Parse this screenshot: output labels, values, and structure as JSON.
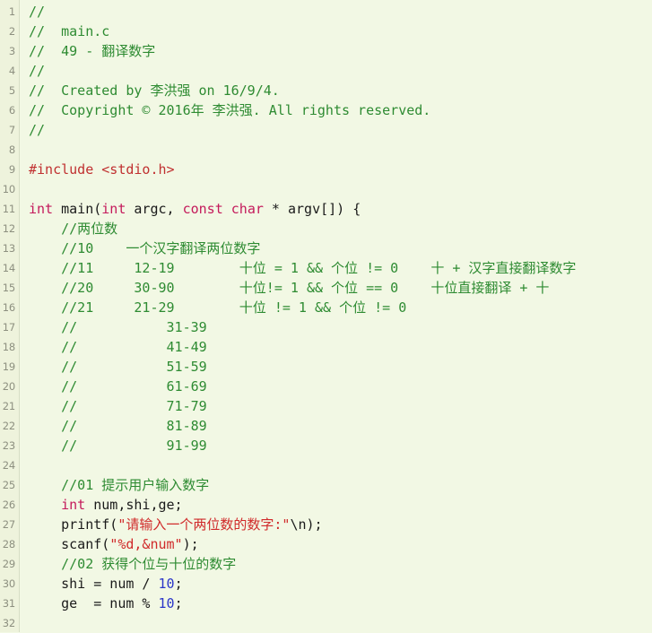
{
  "editor": {
    "language": "c",
    "first_visible_line": 1,
    "last_visible_line": 32,
    "colors": {
      "background": "#f2f8e4",
      "gutter_background": "#eef3dc",
      "gutter_border": "#d6dec4",
      "line_number": "#8d9080",
      "comment": "#2e8b32",
      "keyword": "#c41a5b",
      "preprocessor": "#c03030",
      "string": "#d02a2a",
      "number": "#2b36c8",
      "plain_text": "#1a1a1a"
    }
  },
  "line_numbers": [
    1,
    2,
    3,
    4,
    5,
    6,
    7,
    8,
    9,
    10,
    11,
    12,
    13,
    14,
    15,
    16,
    17,
    18,
    19,
    20,
    21,
    22,
    23,
    24,
    25,
    26,
    27,
    28,
    29,
    30,
    31,
    32
  ],
  "lines": [
    {
      "n": 1,
      "tokens": [
        {
          "t": "//",
          "c": "cmt"
        }
      ]
    },
    {
      "n": 2,
      "tokens": [
        {
          "t": "//  main.c",
          "c": "cmt"
        }
      ]
    },
    {
      "n": 3,
      "tokens": [
        {
          "t": "//  49 - 翻译数字",
          "c": "cmt"
        }
      ]
    },
    {
      "n": 4,
      "tokens": [
        {
          "t": "//",
          "c": "cmt"
        }
      ]
    },
    {
      "n": 5,
      "tokens": [
        {
          "t": "//  Created by 李洪强 on 16/9/4.",
          "c": "cmt"
        }
      ]
    },
    {
      "n": 6,
      "tokens": [
        {
          "t": "//  Copyright © 2016年 李洪强. All rights reserved.",
          "c": "cmt"
        }
      ]
    },
    {
      "n": 7,
      "tokens": [
        {
          "t": "//",
          "c": "cmt"
        }
      ]
    },
    {
      "n": 8,
      "tokens": [
        {
          "t": "",
          "c": "plain"
        }
      ]
    },
    {
      "n": 9,
      "tokens": [
        {
          "t": "#include ",
          "c": "pre"
        },
        {
          "t": "<stdio.h>",
          "c": "pre"
        }
      ]
    },
    {
      "n": 10,
      "tokens": [
        {
          "t": "",
          "c": "plain"
        }
      ]
    },
    {
      "n": 11,
      "tokens": [
        {
          "t": "int",
          "c": "kw"
        },
        {
          "t": " main(",
          "c": "plain"
        },
        {
          "t": "int",
          "c": "kw"
        },
        {
          "t": " argc, ",
          "c": "plain"
        },
        {
          "t": "const",
          "c": "kw"
        },
        {
          "t": " ",
          "c": "plain"
        },
        {
          "t": "char",
          "c": "kw"
        },
        {
          "t": " * argv[]) {",
          "c": "plain"
        }
      ]
    },
    {
      "n": 12,
      "tokens": [
        {
          "t": "    //两位数",
          "c": "cmt"
        }
      ]
    },
    {
      "n": 13,
      "tokens": [
        {
          "t": "    //10    一个汉字翻译两位数字",
          "c": "cmt"
        }
      ]
    },
    {
      "n": 14,
      "tokens": [
        {
          "t": "    //11     12-19        十位 = 1 && 个位 != 0    十 + 汉字直接翻译数字",
          "c": "cmt"
        }
      ]
    },
    {
      "n": 15,
      "tokens": [
        {
          "t": "    //20     30-90        十位!= 1 && 个位 == 0    十位直接翻译 + 十",
          "c": "cmt"
        }
      ]
    },
    {
      "n": 16,
      "tokens": [
        {
          "t": "    //21     21-29        十位 != 1 && 个位 != 0",
          "c": "cmt"
        }
      ]
    },
    {
      "n": 17,
      "tokens": [
        {
          "t": "    //           31-39",
          "c": "cmt"
        }
      ]
    },
    {
      "n": 18,
      "tokens": [
        {
          "t": "    //           41-49",
          "c": "cmt"
        }
      ]
    },
    {
      "n": 19,
      "tokens": [
        {
          "t": "    //           51-59",
          "c": "cmt"
        }
      ]
    },
    {
      "n": 20,
      "tokens": [
        {
          "t": "    //           61-69",
          "c": "cmt"
        }
      ]
    },
    {
      "n": 21,
      "tokens": [
        {
          "t": "    //           71-79",
          "c": "cmt"
        }
      ]
    },
    {
      "n": 22,
      "tokens": [
        {
          "t": "    //           81-89",
          "c": "cmt"
        }
      ]
    },
    {
      "n": 23,
      "tokens": [
        {
          "t": "    //           91-99",
          "c": "cmt"
        }
      ]
    },
    {
      "n": 24,
      "tokens": [
        {
          "t": "",
          "c": "plain"
        }
      ]
    },
    {
      "n": 25,
      "tokens": [
        {
          "t": "    //01 提示用户输入数字",
          "c": "cmt"
        }
      ]
    },
    {
      "n": 26,
      "tokens": [
        {
          "t": "    ",
          "c": "plain"
        },
        {
          "t": "int",
          "c": "kw"
        },
        {
          "t": " num,shi,ge;",
          "c": "plain"
        }
      ]
    },
    {
      "n": 27,
      "tokens": [
        {
          "t": "    printf(",
          "c": "plain"
        },
        {
          "t": "\"请输入一个两位数的数字:\"",
          "c": "str"
        },
        {
          "t": "\\n);",
          "c": "plain"
        }
      ]
    },
    {
      "n": 28,
      "tokens": [
        {
          "t": "    scanf(",
          "c": "plain"
        },
        {
          "t": "\"%d,&num\"",
          "c": "str"
        },
        {
          "t": ");",
          "c": "plain"
        }
      ]
    },
    {
      "n": 29,
      "tokens": [
        {
          "t": "    //02 获得个位与十位的数字",
          "c": "cmt"
        }
      ]
    },
    {
      "n": 30,
      "tokens": [
        {
          "t": "    shi = num / ",
          "c": "plain"
        },
        {
          "t": "10",
          "c": "num"
        },
        {
          "t": ";",
          "c": "plain"
        }
      ]
    },
    {
      "n": 31,
      "tokens": [
        {
          "t": "    ge  = num % ",
          "c": "plain"
        },
        {
          "t": "10",
          "c": "num"
        },
        {
          "t": ";",
          "c": "plain"
        }
      ]
    },
    {
      "n": 32,
      "tokens": [
        {
          "t": "",
          "c": "plain"
        }
      ]
    }
  ]
}
